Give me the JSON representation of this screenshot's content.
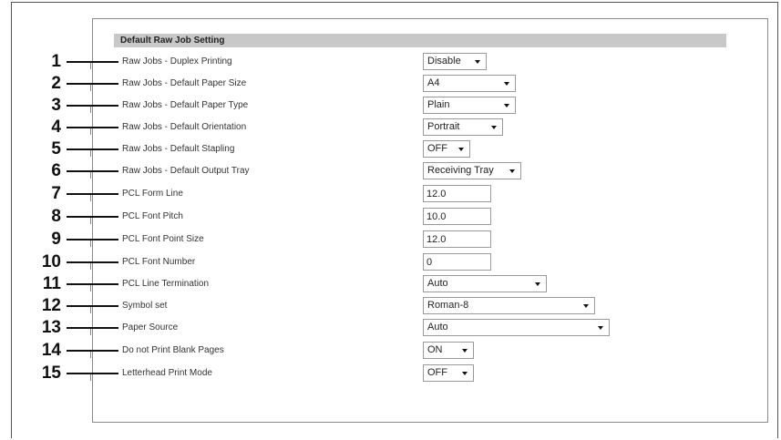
{
  "section": {
    "title": "Default Raw Job Setting"
  },
  "rows": [
    {
      "num": "1",
      "label": "Raw Jobs - Duplex Printing",
      "type": "select",
      "value": "Disable"
    },
    {
      "num": "2",
      "label": "Raw Jobs - Default Paper Size",
      "type": "select",
      "value": "A4"
    },
    {
      "num": "3",
      "label": "Raw Jobs - Default Paper Type",
      "type": "select",
      "value": "Plain"
    },
    {
      "num": "4",
      "label": "Raw Jobs - Default Orientation",
      "type": "select",
      "value": "Portrait"
    },
    {
      "num": "5",
      "label": "Raw Jobs - Default Stapling",
      "type": "select",
      "value": "OFF"
    },
    {
      "num": "6",
      "label": "Raw Jobs - Default Output Tray",
      "type": "select",
      "value": "Receiving Tray"
    },
    {
      "num": "7",
      "label": "PCL Form Line",
      "type": "text",
      "value": "12.0"
    },
    {
      "num": "8",
      "label": "PCL Font Pitch",
      "type": "text",
      "value": "10.0"
    },
    {
      "num": "9",
      "label": "PCL Font Point Size",
      "type": "text",
      "value": "12.0"
    },
    {
      "num": "10",
      "label": "PCL Font Number",
      "type": "text",
      "value": "0"
    },
    {
      "num": "11",
      "label": "PCL Line Termination",
      "type": "select",
      "value": "Auto"
    },
    {
      "num": "12",
      "label": "Symbol set",
      "type": "select",
      "value": "Roman-8"
    },
    {
      "num": "13",
      "label": "Paper Source",
      "type": "select",
      "value": "Auto"
    },
    {
      "num": "14",
      "label": "Do not Print Blank Pages",
      "type": "select",
      "value": "ON"
    },
    {
      "num": "15",
      "label": "Letterhead Print Mode",
      "type": "select",
      "value": "OFF"
    }
  ],
  "icons": {
    "dropdown": "chevron-down-icon"
  }
}
